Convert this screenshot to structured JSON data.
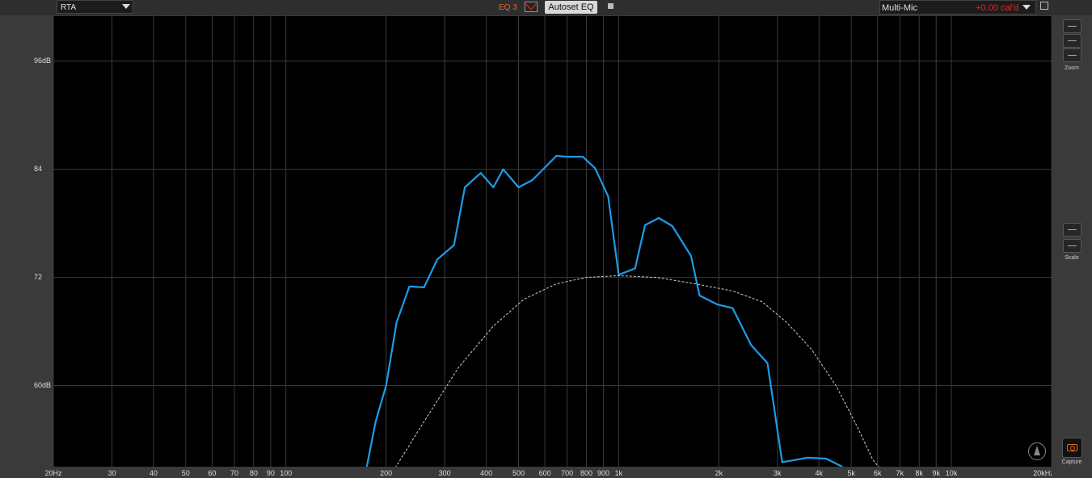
{
  "toolbar": {
    "view_mode": "RTA",
    "eq_label": "EQ 3",
    "autoset_label": "Autoset EQ",
    "mic_name": "Multi-Mic",
    "cal_value": "+0.00 cal'd"
  },
  "side": {
    "zoom_label": "Zoom",
    "scale_label": "Scale",
    "capture_label": "Capture"
  },
  "chart_data": {
    "type": "line",
    "x_scale": "log",
    "xlim": [
      20,
      20000
    ],
    "ylim": [
      51,
      101
    ],
    "y_ticks": [
      {
        "value": 96,
        "label": "96dB"
      },
      {
        "value": 84,
        "label": "84"
      },
      {
        "value": 72,
        "label": "72"
      },
      {
        "value": 60,
        "label": "60dB"
      }
    ],
    "x_ticks": [
      {
        "value": 20,
        "label": "20Hz"
      },
      {
        "value": 30,
        "label": "30"
      },
      {
        "value": 40,
        "label": "40"
      },
      {
        "value": 50,
        "label": "50"
      },
      {
        "value": 60,
        "label": "60"
      },
      {
        "value": 70,
        "label": "70"
      },
      {
        "value": 80,
        "label": "80"
      },
      {
        "value": 90,
        "label": "90"
      },
      {
        "value": 100,
        "label": "100"
      },
      {
        "value": 200,
        "label": "200"
      },
      {
        "value": 300,
        "label": "300"
      },
      {
        "value": 400,
        "label": "400"
      },
      {
        "value": 500,
        "label": "500"
      },
      {
        "value": 600,
        "label": "600"
      },
      {
        "value": 700,
        "label": "700"
      },
      {
        "value": 800,
        "label": "800"
      },
      {
        "value": 900,
        "label": "900"
      },
      {
        "value": 1000,
        "label": "1k"
      },
      {
        "value": 2000,
        "label": "2k"
      },
      {
        "value": 3000,
        "label": "3k"
      },
      {
        "value": 4000,
        "label": "4k"
      },
      {
        "value": 5000,
        "label": "5k"
      },
      {
        "value": 6000,
        "label": "6k"
      },
      {
        "value": 7000,
        "label": "7k"
      },
      {
        "value": 8000,
        "label": "8k"
      },
      {
        "value": 9000,
        "label": "9k"
      },
      {
        "value": 10000,
        "label": "10k"
      },
      {
        "value": 20000,
        "label": "20kHz"
      }
    ],
    "grid": true,
    "series": [
      {
        "color": "#1e9be8",
        "points": [
          [
            175,
            51
          ],
          [
            186,
            56
          ],
          [
            200,
            60
          ],
          [
            215,
            67
          ],
          [
            235,
            71
          ],
          [
            260,
            70.9
          ],
          [
            285,
            74
          ],
          [
            320,
            75.6
          ],
          [
            345,
            82
          ],
          [
            385,
            83.6
          ],
          [
            420,
            82
          ],
          [
            450,
            84
          ],
          [
            500,
            82
          ],
          [
            550,
            82.8
          ],
          [
            600,
            84.2
          ],
          [
            650,
            85.5
          ],
          [
            700,
            85.4
          ],
          [
            780,
            85.4
          ],
          [
            850,
            84.1
          ],
          [
            930,
            81
          ],
          [
            1000,
            72.3
          ],
          [
            1120,
            73
          ],
          [
            1200,
            77.8
          ],
          [
            1320,
            78.6
          ],
          [
            1450,
            77.7
          ],
          [
            1650,
            74.4
          ],
          [
            1750,
            70
          ],
          [
            1980,
            69
          ],
          [
            2200,
            68.6
          ],
          [
            2500,
            64.5
          ],
          [
            2800,
            62.5
          ],
          [
            3100,
            51.5
          ],
          [
            3700,
            52
          ],
          [
            4200,
            51.9
          ],
          [
            4700,
            51
          ]
        ]
      },
      {
        "color": "#cfcfcf",
        "dashed": true,
        "points": [
          [
            210,
            50.5
          ],
          [
            260,
            56
          ],
          [
            330,
            62
          ],
          [
            420,
            66.6
          ],
          [
            520,
            69.6
          ],
          [
            650,
            71.3
          ],
          [
            800,
            72
          ],
          [
            1000,
            72.2
          ],
          [
            1300,
            72
          ],
          [
            1700,
            71.3
          ],
          [
            2200,
            70.5
          ],
          [
            2700,
            69.3
          ],
          [
            3200,
            67
          ],
          [
            3800,
            64
          ],
          [
            4500,
            60
          ],
          [
            5200,
            55.5
          ],
          [
            5800,
            51.8
          ],
          [
            6200,
            50.5
          ]
        ]
      }
    ]
  }
}
